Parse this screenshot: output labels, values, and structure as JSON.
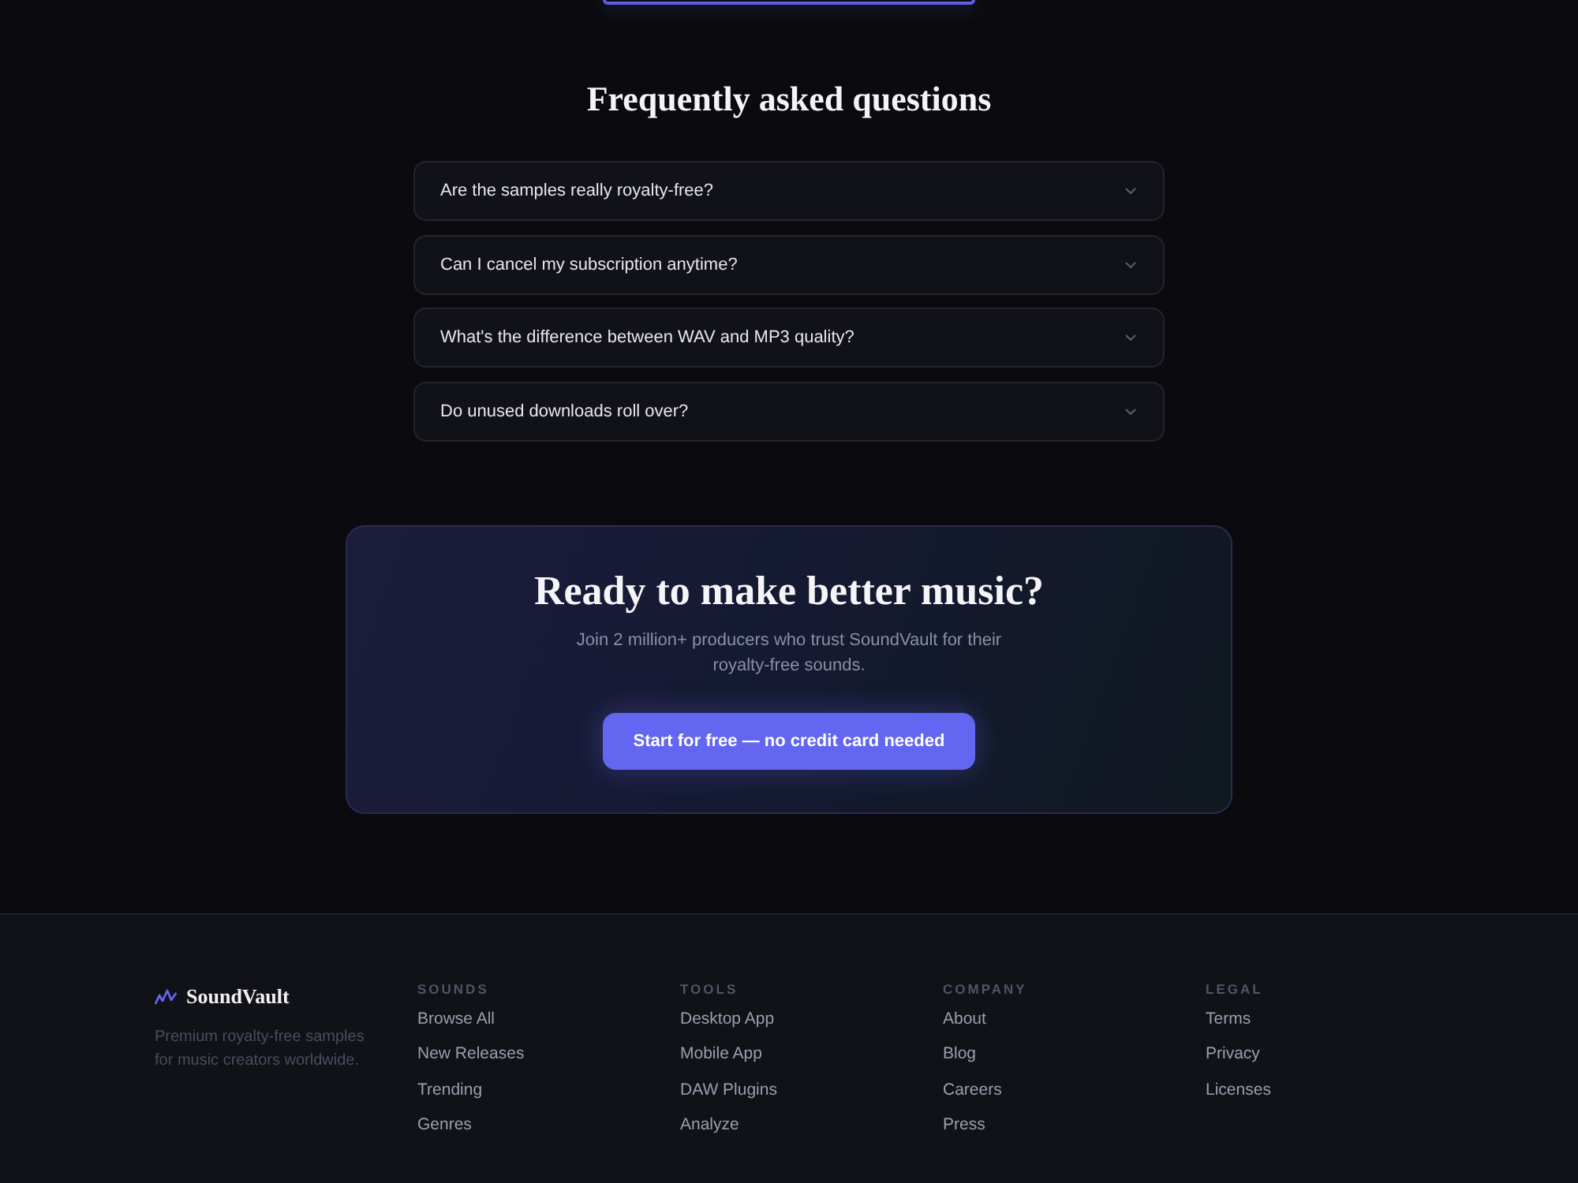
{
  "faq": {
    "title": "Frequently asked questions",
    "items": [
      {
        "question": "Are the samples really royalty-free?",
        "expanded": false
      },
      {
        "question": "Can I cancel my subscription anytime?",
        "expanded": false
      },
      {
        "question": "What's the difference between WAV and MP3 quality?",
        "expanded": false
      },
      {
        "question": "Do unused downloads roll over?",
        "expanded": false
      }
    ]
  },
  "cta": {
    "title": "Ready to make better music?",
    "subtitle": "Join 2 million+ producers who trust SoundVault for their royalty-free sounds.",
    "button": "Start for free — no credit card needed"
  },
  "footer": {
    "brand": {
      "name": "SoundVault",
      "tagline": "Premium royalty-free samples for music creators worldwide."
    },
    "columns": [
      {
        "heading": "SOUNDS",
        "links": [
          "Browse All",
          "New Releases",
          "Trending",
          "Genres"
        ]
      },
      {
        "heading": "TOOLS",
        "links": [
          "Desktop App",
          "Mobile App",
          "DAW Plugins",
          "Analyze"
        ]
      },
      {
        "heading": "COMPANY",
        "links": [
          "About",
          "Blog",
          "Careers",
          "Press"
        ]
      },
      {
        "heading": "LEGAL",
        "links": [
          "Terms",
          "Privacy",
          "Licenses"
        ]
      }
    ]
  }
}
